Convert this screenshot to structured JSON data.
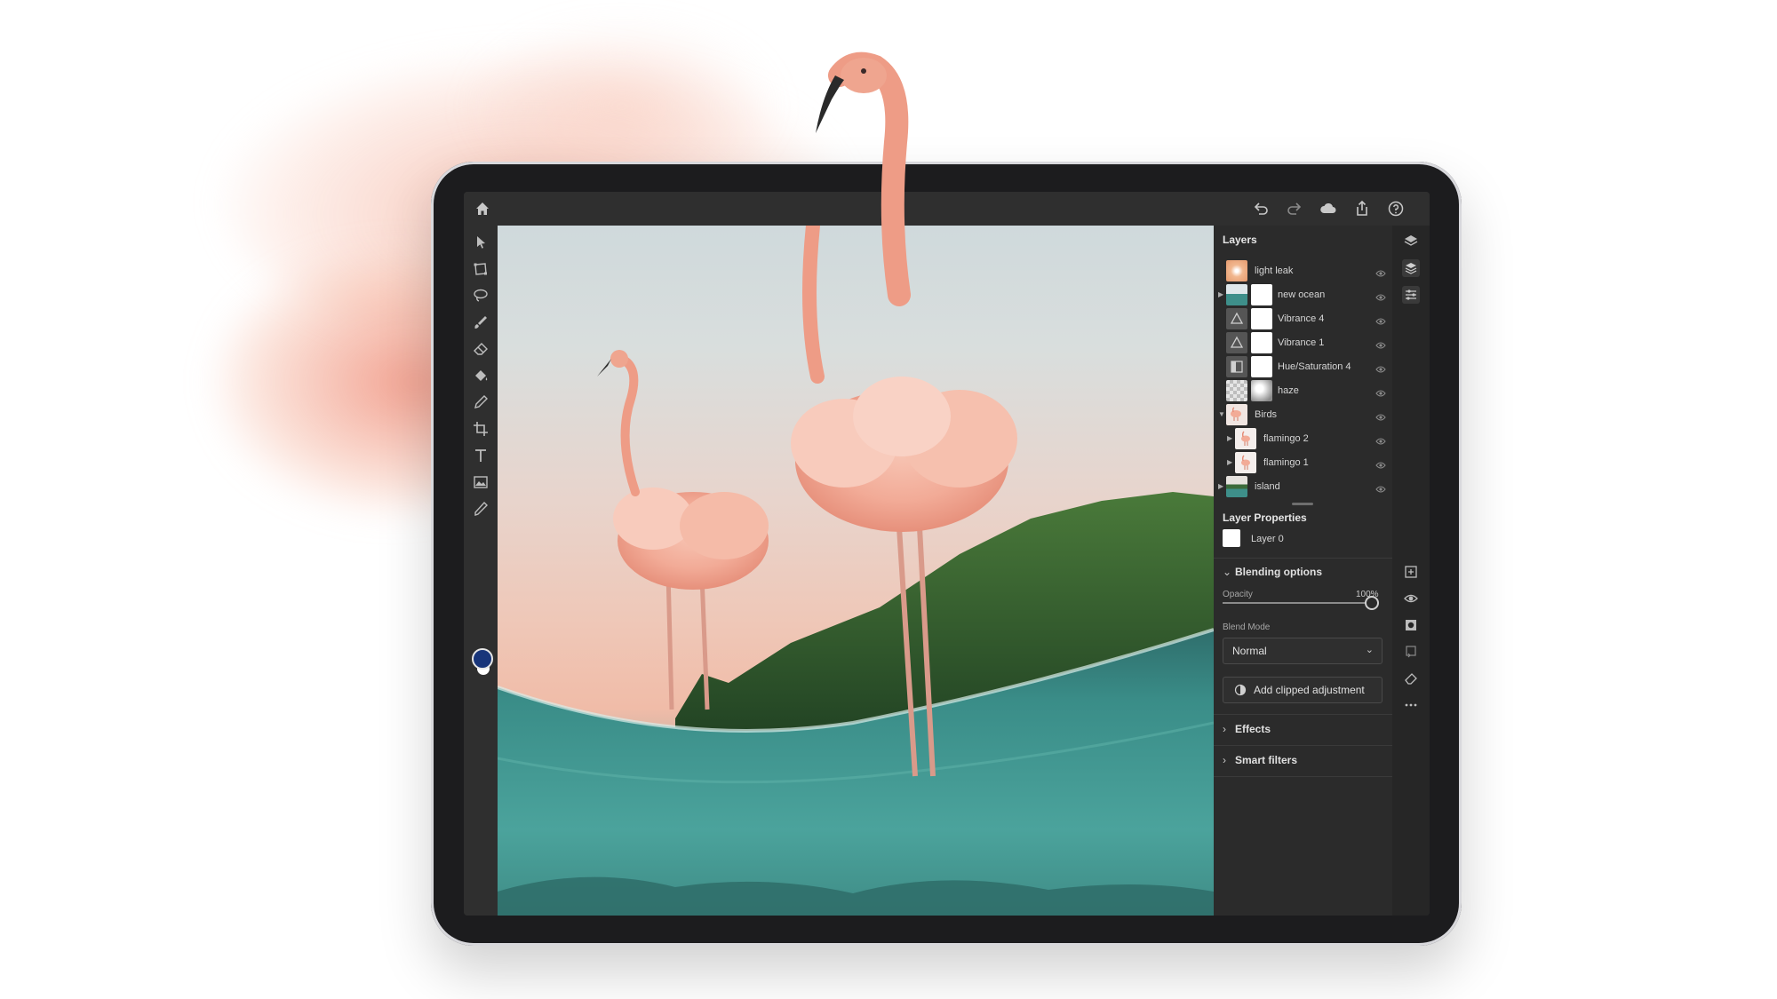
{
  "layers_panel": {
    "title": "Layers",
    "layers": [
      {
        "name": "light leak"
      },
      {
        "name": "new ocean"
      },
      {
        "name": "Vibrance 4"
      },
      {
        "name": "Vibrance 1"
      },
      {
        "name": "Hue/Saturation 4"
      },
      {
        "name": "haze"
      },
      {
        "name": "Birds"
      },
      {
        "name": "flamingo 2"
      },
      {
        "name": "flamingo 1"
      },
      {
        "name": "island"
      }
    ]
  },
  "layer_properties": {
    "title": "Layer Properties",
    "layer_name": "Layer 0"
  },
  "blending": {
    "title": "Blending options",
    "opacity_label": "Opacity",
    "opacity_value": "100%",
    "opacity_fraction": 1.0,
    "blend_mode_label": "Blend Mode",
    "blend_mode_value": "Normal",
    "add_adjustment_label": "Add clipped adjustment"
  },
  "sections": {
    "effects": "Effects",
    "smart_filters": "Smart filters"
  },
  "colors": {
    "foreground": "#18357a",
    "background": "#ffffff",
    "ui_dark": "#2b2b2b"
  }
}
